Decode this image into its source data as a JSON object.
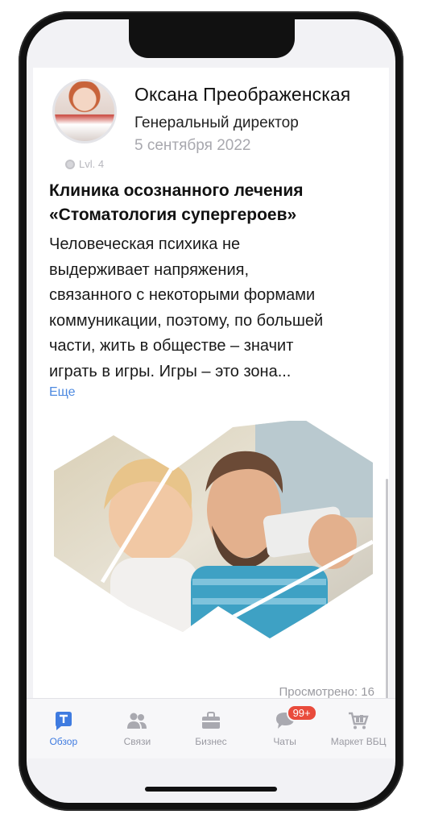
{
  "author": {
    "name": "Оксана Преображенская",
    "role": "Генеральный директор",
    "date": "5 сентября 2022",
    "level": "Lvl. 4"
  },
  "post": {
    "title": "Клиника осознанного лечения\n«Стоматология супергероев»",
    "body": "Человеческая психика не\nвыдерживает напряжения,\nсвязанного с некоторыми формами\nкоммуникации, поэтому, по большей\nчасти, жить в обществе – значит\nиграть в игры. Игры – это зона...",
    "more_label": "Еще",
    "views": "Просмотрено: 16"
  },
  "tabs": [
    {
      "label": "Обзор",
      "icon": "chat-t-icon",
      "active": true
    },
    {
      "label": "Связи",
      "icon": "people-icon"
    },
    {
      "label": "Бизнес",
      "icon": "briefcase-icon"
    },
    {
      "label": "Чаты",
      "icon": "chat-bubble-icon",
      "badge": "99+"
    },
    {
      "label": "Маркет ВБЦ",
      "icon": "cart-icon"
    }
  ],
  "colors": {
    "accent": "#3f7be0",
    "link": "#4e8ae0",
    "badge": "#e94b3c"
  }
}
